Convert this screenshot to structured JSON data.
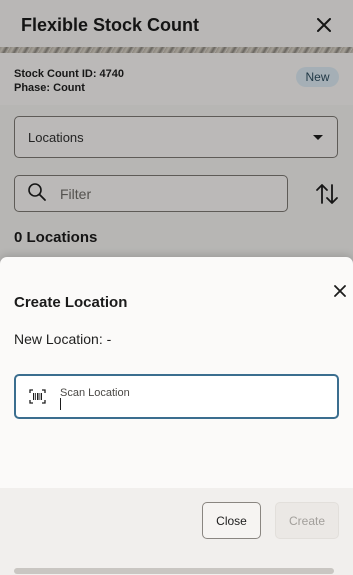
{
  "header": {
    "title": "Flexible Stock Count",
    "close_icon": "close-icon"
  },
  "info": {
    "stock_count_id": "Stock Count ID: 4740",
    "phase": "Phase: Count",
    "status_badge": "New"
  },
  "filters": {
    "locations_select": "Locations",
    "filter_placeholder": "Filter"
  },
  "list": {
    "count_heading": "0 Locations"
  },
  "dialog": {
    "title": "Create Location",
    "new_location": "New Location: -",
    "scan_field_label": "Scan Location",
    "close_button": "Close",
    "create_button": "Create"
  },
  "colors": {
    "badge_bg": "#d9e7ef",
    "focus_border": "#3b6e8f",
    "disabled_text": "#a29f9b"
  }
}
